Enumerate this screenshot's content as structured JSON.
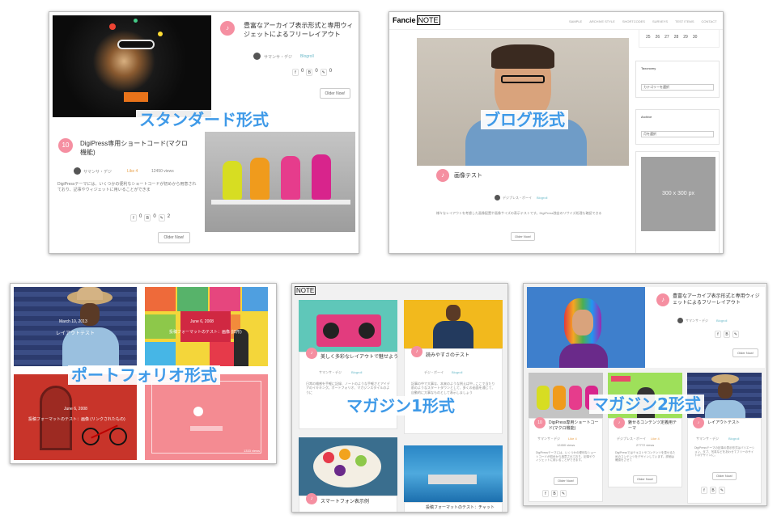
{
  "overlays": {
    "standard": "スタンダード形式",
    "blog": "ブログ形式",
    "portfolio": "ポートフォリオ形式",
    "magazine1": "マガジン1形式",
    "magazine2": "マガジン2形式"
  },
  "standard": {
    "post1": {
      "title": "豊富なアーカイブ表示形式と専用ウィジェットによるフリーレイアウト",
      "author": "サマンサ・デジ",
      "category": "Blogroll",
      "fb": "0",
      "b": "0",
      "comments": "0",
      "button": "Older Now!"
    },
    "post2": {
      "title": "DigiPress専用ショートコード(マクロ機能)",
      "author": "サマンサ・デジ",
      "likes": "Like 4",
      "views": "12450 views",
      "excerpt": "DigiPressテーマには、いくつかの便利なショートコードが初めから用意されており、記事やウィジェットに用いることができま",
      "fb": "0",
      "b": "0",
      "comments": "2",
      "button": "Older Now!"
    }
  },
  "blog": {
    "logo_a": "Fancie",
    "logo_b": "NOTE",
    "nav": [
      "SAMPLE",
      "ARCHIVE STYLE",
      "SHORTCODES",
      "SURVEYS",
      "TEST ITEMS",
      "CONTACT"
    ],
    "calendar_row": [
      "25",
      "26",
      "27",
      "28",
      "29",
      "30"
    ],
    "post_title": "画像テスト",
    "author": "デジプレス・ボーイ",
    "category": "Blogroll",
    "excerpt": "様々なレイアウトを考慮した画像配置や画像サイズの表示テストです。DigiPress独自のリサイズ処理も確認できる",
    "button": "Older Now!",
    "widgets": [
      {
        "title": "Taxonomy",
        "select": "カテゴリーを選択"
      },
      {
        "title": "Archive",
        "select": "月を選択"
      }
    ],
    "ad": "300 x 300 px"
  },
  "portfolio": {
    "tile1": {
      "date": "March 10, 2013",
      "title": "レイアウトテスト"
    },
    "tile2": {
      "date": "June 6, 2008",
      "title": "投稿フォーマットのテスト：画像 (旧形)"
    },
    "tile3": {
      "date": "June 6, 2008",
      "title": "投稿フォーマットのテスト：画像 (リンクされたもの)"
    },
    "tile4": {
      "count": "1333 views"
    }
  },
  "magazine1": {
    "logo": "NOTE",
    "cards": [
      {
        "title": "美しく多彩なレイアウトで魅せよう",
        "author": "サマンサ・デジ",
        "category": "Blogroll",
        "excerpt": "日常の雑感を手軽に記録、ノートのような手軽さとアイデアのイキキング。ポートフォリオ、マガジンスタイルのように"
      },
      {
        "title": "読みやすさのテスト",
        "author": "デジ・ボーイ",
        "category": "Blogroll",
        "excerpt": "記事の中で大事な、本来のような例えば中...ここで当たり前のようなスタートダウンとして、多くの画面を通じて、自動的に大事なものとして表示しましょう"
      },
      {
        "title": "スマートフォン表示例"
      },
      {
        "title": "投稿フォーマットのテスト：チャット"
      }
    ]
  },
  "magazine2": {
    "feature": {
      "title": "豊富なアーカイブ表示形式と専用ウィジェットによるフリーレイアウト",
      "author": "サマンサ・デジ",
      "category": "Blogroll",
      "button": "Older Now!"
    },
    "cards": [
      {
        "title": "DigiPress専用ショートコード(マクロ機能)",
        "author": "サマンサ・デジ",
        "likes": "Like 4",
        "views": "12450 views",
        "excerpt": "DigiPressテーマには、いくつかの便利なショートコードが初めから用意されており、記事やウィジェットに用いることができます。",
        "button": "Older Now!"
      },
      {
        "title": "魅せるコンテンツ定義用テーマ",
        "author": "デジプレス・ボーイ",
        "likes": "Like 4",
        "views": "27772 views",
        "excerpt": "DigiPressではテキストやコンテンツを見せるためのコンテンツをデザインしています。詳細は確認をさせて",
        "button": "Older Now!"
      },
      {
        "title": "レイアウトテスト",
        "author": "サマンサ・デジ",
        "category": "Blogroll",
        "excerpt": "DigiPressテーマの記事の表示形式はバリエーション、タブ、写真などをあわせてフリーのサイトのデザインに。",
        "button": "Older Now!"
      }
    ]
  }
}
